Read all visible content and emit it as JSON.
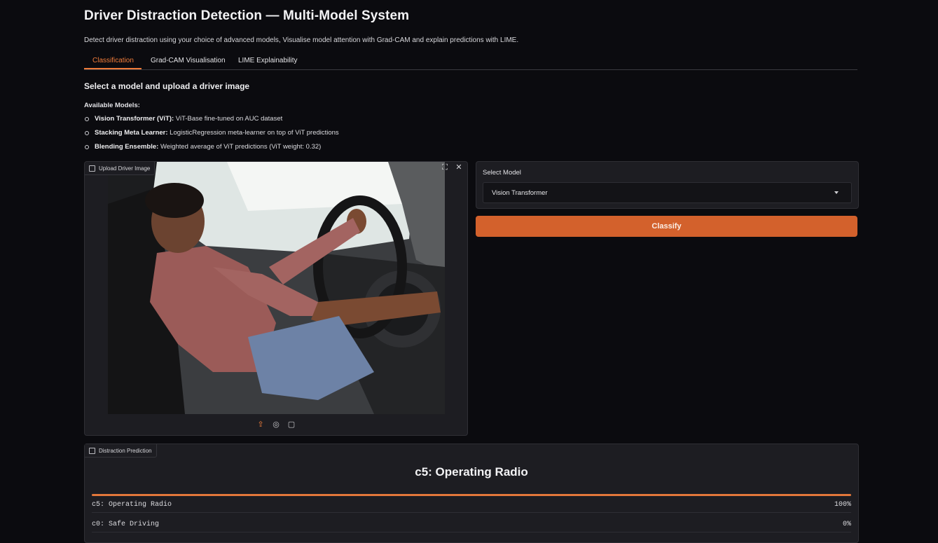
{
  "header": {
    "title": "Driver Distraction Detection — Multi-Model System",
    "subtitle": "Detect driver distraction using your choice of advanced models, Visualise model attention with Grad-CAM and explain predictions with LIME."
  },
  "tabs": [
    {
      "label": "Classification",
      "active": true
    },
    {
      "label": "Grad-CAM Visualisation",
      "active": false
    },
    {
      "label": "LIME Explainability",
      "active": false
    }
  ],
  "classification": {
    "section_title": "Select a model and upload a driver image",
    "available_label": "Available Models:",
    "models": [
      {
        "name": "Vision Transformer (ViT):",
        "desc": " ViT-Base fine-tuned on AUC dataset"
      },
      {
        "name": "Stacking Meta Learner:",
        "desc": " LogisticRegression meta-learner on top of ViT predictions"
      },
      {
        "name": "Blending Ensemble:",
        "desc": " Weighted average of ViT predictions (ViT weight: 0.32)"
      }
    ],
    "upload_label": "Upload Driver Image",
    "select_label": "Select Model",
    "selected_model": "Vision Transformer",
    "classify_label": "Classify",
    "prediction_label": "Distraction Prediction",
    "prediction_title": "c5: Operating Radio",
    "predictions": [
      {
        "label": "c5: Operating Radio",
        "value": "100%",
        "confidence": 1.0
      },
      {
        "label": "c0: Safe Driving",
        "value": "0%",
        "confidence": 0.0
      }
    ]
  },
  "colors": {
    "accent": "#f07c3a",
    "button": "#d3612c",
    "background": "#0b0b0f",
    "panel": "#1d1d22"
  },
  "icons": [
    "image-icon",
    "fullscreen-icon",
    "close-icon",
    "upload-icon",
    "webcam-icon",
    "clipboard-icon",
    "chart-icon",
    "chevron-down-icon"
  ]
}
